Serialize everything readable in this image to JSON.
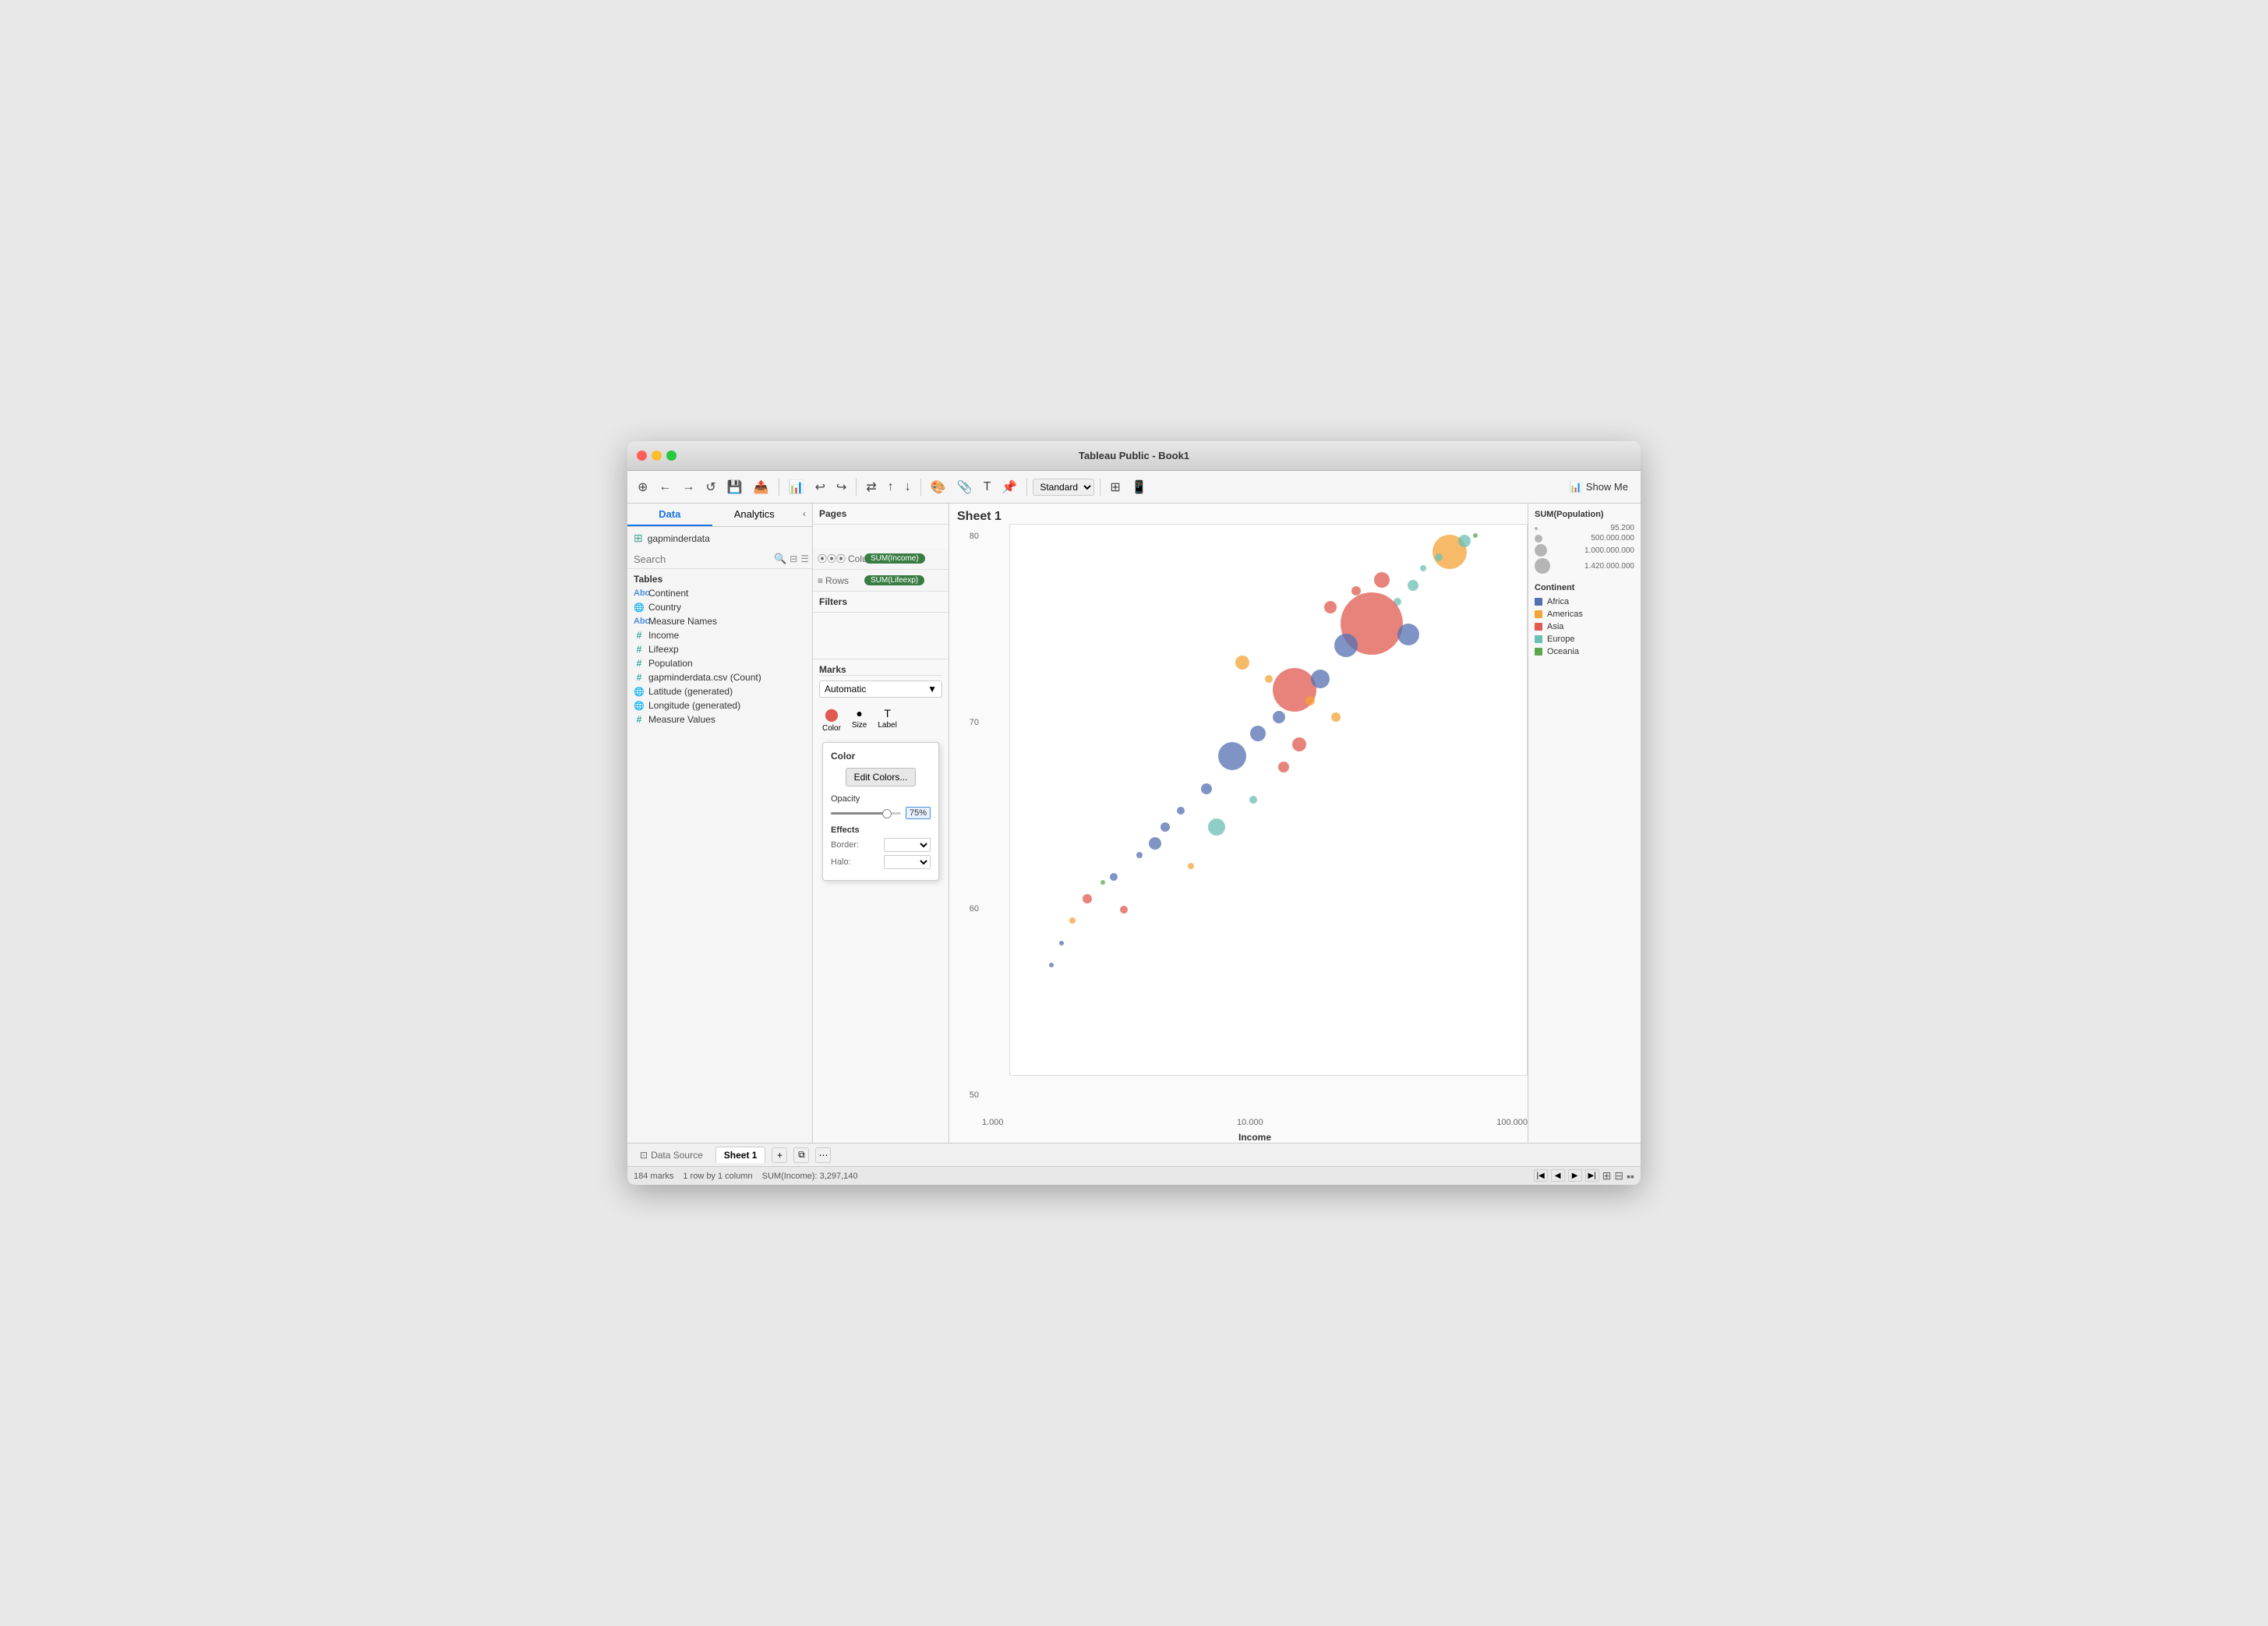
{
  "window": {
    "title": "Tableau Public - Book1"
  },
  "toolbar": {
    "show_me": "Show Me"
  },
  "tabs": {
    "data": "Data",
    "analytics": "Analytics"
  },
  "datasource": "gapminderdata",
  "search": {
    "placeholder": "Search"
  },
  "tables_label": "Tables",
  "fields": [
    {
      "name": "Continent",
      "type": "abc",
      "icon": "Abc"
    },
    {
      "name": "Country",
      "type": "globe",
      "icon": "🌐"
    },
    {
      "name": "Measure Names",
      "type": "abc",
      "icon": "Abc"
    },
    {
      "name": "Income",
      "type": "hash",
      "icon": "#"
    },
    {
      "name": "Lifeexp",
      "type": "hash",
      "icon": "#"
    },
    {
      "name": "Population",
      "type": "hash",
      "icon": "#"
    },
    {
      "name": "gapminderdata.csv (Count)",
      "type": "hash",
      "icon": "#"
    },
    {
      "name": "Latitude (generated)",
      "type": "globe",
      "icon": "🌐"
    },
    {
      "name": "Longitude (generated)",
      "type": "globe",
      "icon": "🌐"
    },
    {
      "name": "Measure Values",
      "type": "hash",
      "icon": "#"
    }
  ],
  "pages_label": "Pages",
  "filters_label": "Filters",
  "marks_label": "Marks",
  "marks_type": "Automatic",
  "mark_cards": [
    {
      "label": "Color",
      "icon": "⬤"
    },
    {
      "label": "Size",
      "icon": "●"
    },
    {
      "label": "Label",
      "icon": "T"
    }
  ],
  "color_popup": {
    "title": "Color",
    "edit_colors_btn": "Edit Colors...",
    "opacity_label": "Opacity",
    "opacity_value": "75%",
    "effects_label": "Effects",
    "border_label": "Border:",
    "halo_label": "Halo:"
  },
  "shelf": {
    "columns_label": "Columns",
    "rows_label": "Rows",
    "columns_pill": "SUM(Income)",
    "rows_pill": "SUM(Lifeexp)"
  },
  "chart": {
    "title": "Sheet 1",
    "x_axis_label": "Income",
    "y_axis": [
      "80",
      "70",
      "60",
      "50"
    ],
    "x_axis": [
      "1.000",
      "10.000",
      "100.000"
    ]
  },
  "size_legend": {
    "title": "SUM(Population)",
    "items": [
      {
        "value": "95.200",
        "size": 4
      },
      {
        "value": "500.000.000",
        "size": 10
      },
      {
        "value": "1.000.000.000",
        "size": 16
      },
      {
        "value": "1.420.000.000",
        "size": 20
      }
    ]
  },
  "color_legend": {
    "title": "Continent",
    "items": [
      {
        "label": "Africa",
        "color": "#5470b0"
      },
      {
        "label": "Americas",
        "color": "#f4a336"
      },
      {
        "label": "Asia",
        "color": "#e05a4f"
      },
      {
        "label": "Europe",
        "color": "#6bbfb5"
      },
      {
        "label": "Oceania",
        "color": "#5da64e"
      }
    ]
  },
  "bottom": {
    "data_source": "Data Source",
    "sheet1": "Sheet 1"
  },
  "status": {
    "marks": "184 marks",
    "rows": "1 row by 1 column",
    "sum": "SUM(Income): 3,297,140"
  },
  "bubbles": [
    {
      "x": 62,
      "y": 15,
      "r": 8,
      "color": "#e05a4f"
    },
    {
      "x": 67,
      "y": 12,
      "r": 6,
      "color": "#e05a4f"
    },
    {
      "x": 72,
      "y": 10,
      "r": 10,
      "color": "#e05a4f"
    },
    {
      "x": 75,
      "y": 14,
      "r": 5,
      "color": "#6bbfb5"
    },
    {
      "x": 78,
      "y": 11,
      "r": 7,
      "color": "#6bbfb5"
    },
    {
      "x": 80,
      "y": 8,
      "r": 4,
      "color": "#6bbfb5"
    },
    {
      "x": 70,
      "y": 18,
      "r": 40,
      "color": "#e05a4f"
    },
    {
      "x": 65,
      "y": 22,
      "r": 15,
      "color": "#5470b0"
    },
    {
      "x": 55,
      "y": 30,
      "r": 28,
      "color": "#e05a4f"
    },
    {
      "x": 60,
      "y": 28,
      "r": 12,
      "color": "#5470b0"
    },
    {
      "x": 52,
      "y": 35,
      "r": 8,
      "color": "#5470b0"
    },
    {
      "x": 48,
      "y": 38,
      "r": 10,
      "color": "#5470b0"
    },
    {
      "x": 43,
      "y": 42,
      "r": 18,
      "color": "#5470b0"
    },
    {
      "x": 58,
      "y": 32,
      "r": 6,
      "color": "#f4a336"
    },
    {
      "x": 50,
      "y": 28,
      "r": 5,
      "color": "#f4a336"
    },
    {
      "x": 45,
      "y": 25,
      "r": 9,
      "color": "#f4a336"
    },
    {
      "x": 38,
      "y": 48,
      "r": 7,
      "color": "#5470b0"
    },
    {
      "x": 33,
      "y": 52,
      "r": 5,
      "color": "#5470b0"
    },
    {
      "x": 30,
      "y": 55,
      "r": 6,
      "color": "#5470b0"
    },
    {
      "x": 28,
      "y": 58,
      "r": 8,
      "color": "#5470b0"
    },
    {
      "x": 25,
      "y": 60,
      "r": 4,
      "color": "#5470b0"
    },
    {
      "x": 20,
      "y": 64,
      "r": 5,
      "color": "#5470b0"
    },
    {
      "x": 15,
      "y": 68,
      "r": 6,
      "color": "#e05a4f"
    },
    {
      "x": 12,
      "y": 72,
      "r": 4,
      "color": "#f4a336"
    },
    {
      "x": 10,
      "y": 76,
      "r": 3,
      "color": "#5470b0"
    },
    {
      "x": 8,
      "y": 80,
      "r": 3,
      "color": "#5470b0"
    },
    {
      "x": 85,
      "y": 5,
      "r": 22,
      "color": "#f4a336"
    },
    {
      "x": 88,
      "y": 3,
      "r": 8,
      "color": "#6bbfb5"
    },
    {
      "x": 83,
      "y": 6,
      "r": 5,
      "color": "#6bbfb5"
    },
    {
      "x": 77,
      "y": 20,
      "r": 14,
      "color": "#5470b0"
    },
    {
      "x": 63,
      "y": 35,
      "r": 6,
      "color": "#f4a336"
    },
    {
      "x": 56,
      "y": 40,
      "r": 9,
      "color": "#e05a4f"
    },
    {
      "x": 53,
      "y": 44,
      "r": 7,
      "color": "#e05a4f"
    },
    {
      "x": 47,
      "y": 50,
      "r": 5,
      "color": "#6bbfb5"
    },
    {
      "x": 40,
      "y": 55,
      "r": 11,
      "color": "#6bbfb5"
    },
    {
      "x": 35,
      "y": 62,
      "r": 4,
      "color": "#f4a336"
    },
    {
      "x": 22,
      "y": 70,
      "r": 5,
      "color": "#e05a4f"
    },
    {
      "x": 18,
      "y": 65,
      "r": 3,
      "color": "#5da64e"
    },
    {
      "x": 90,
      "y": 2,
      "r": 3,
      "color": "#5da64e"
    }
  ]
}
